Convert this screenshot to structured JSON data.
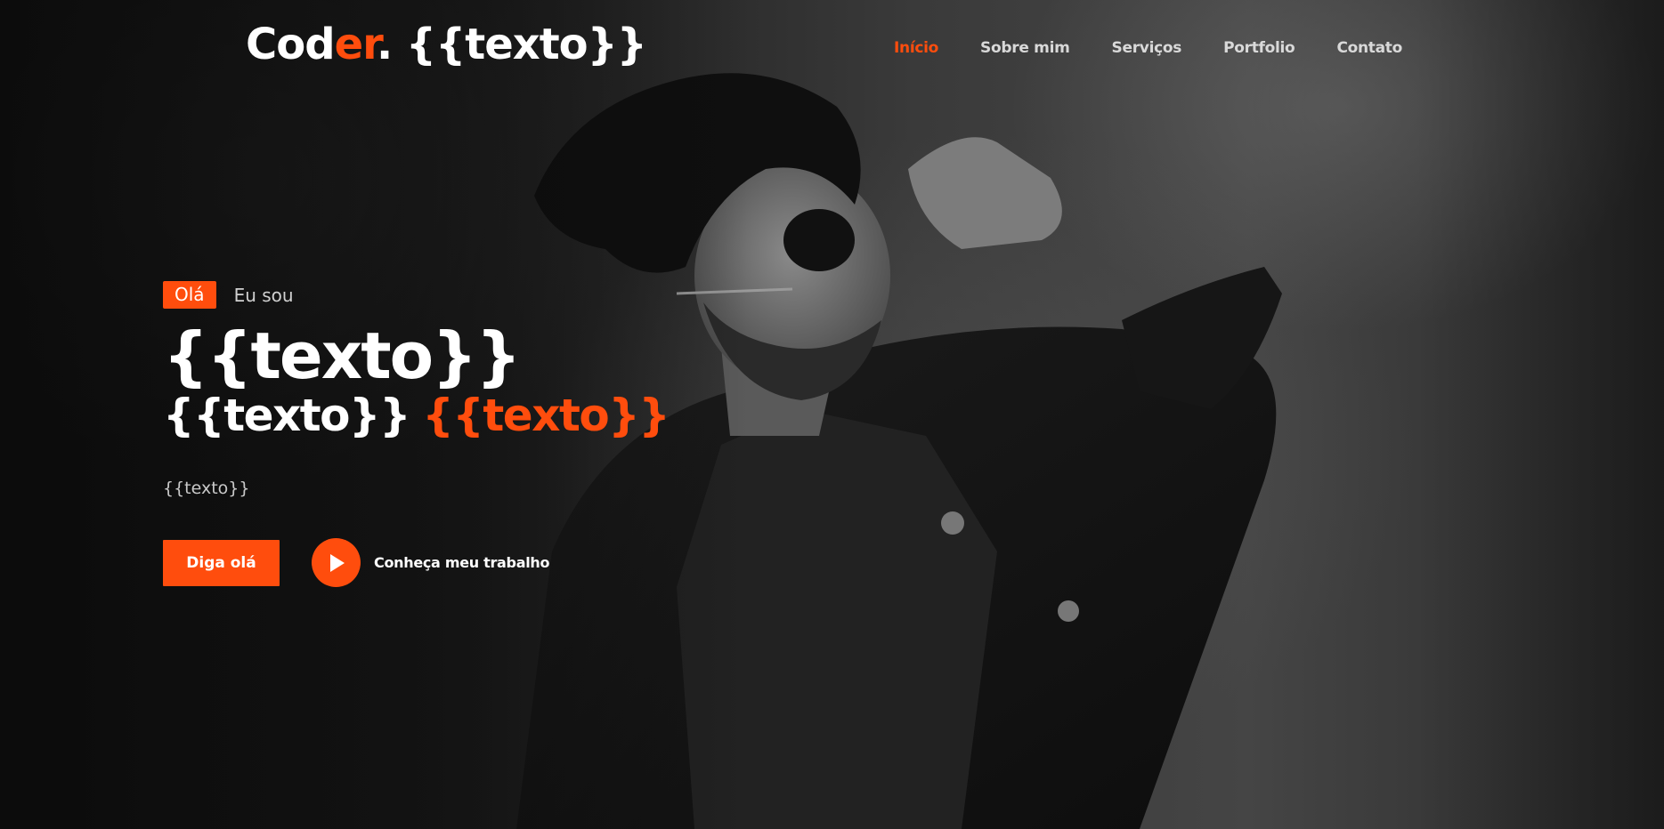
{
  "colors": {
    "accent": "#ff4d0d",
    "text": "#ffffff",
    "muted": "#c9c9c9",
    "background": "#1a1a1a"
  },
  "header": {
    "logo_main": "Cod",
    "logo_accent": "er",
    "logo_dot": ".",
    "logo_template": "{{texto}}"
  },
  "nav": {
    "items": [
      {
        "label": "Início",
        "active": true
      },
      {
        "label": "Sobre mim",
        "active": false
      },
      {
        "label": "Serviços",
        "active": false
      },
      {
        "label": "Portfolio",
        "active": false
      },
      {
        "label": "Contato",
        "active": false
      }
    ]
  },
  "hero": {
    "badge": "Olá",
    "intro": "Eu sou",
    "name": "{{texto}}",
    "role_white": "{{texto}}",
    "role_accent": "{{texto}}",
    "description": "{{texto}}",
    "primary_button": "Diga olá",
    "secondary_link": "Conheça meu trabalho",
    "play_icon": "play-icon"
  }
}
